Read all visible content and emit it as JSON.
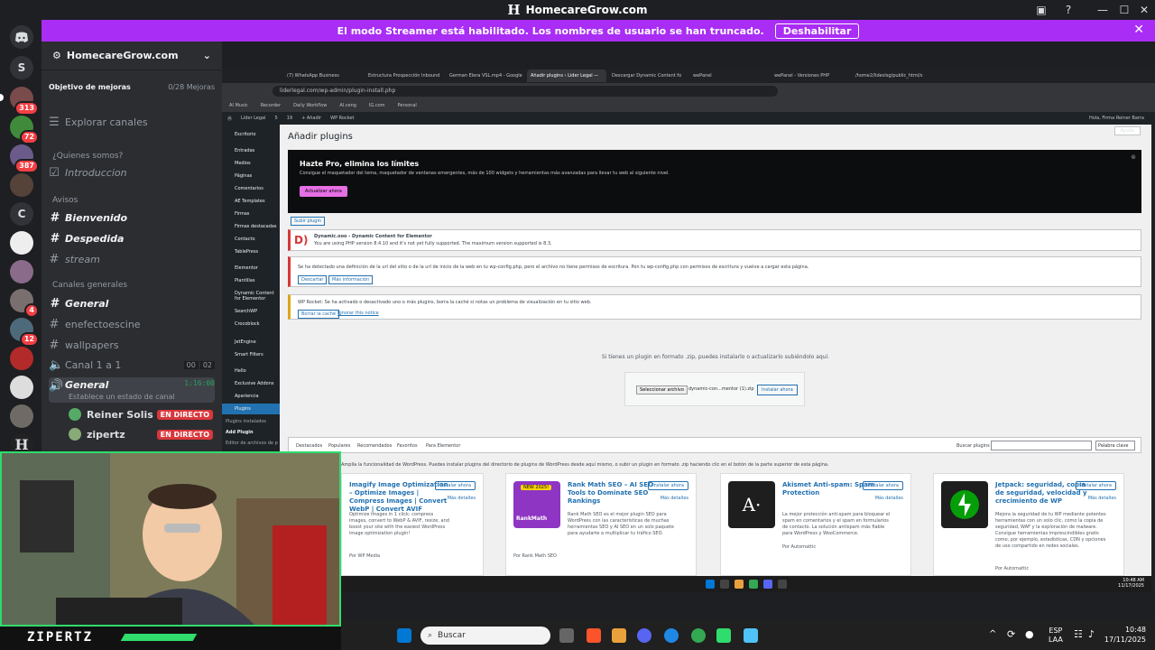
{
  "window": {
    "title": "HomecareGrow.com"
  },
  "streamer": {
    "message": "El modo Streamer está habilitado. Los nombres de usuario se han truncado.",
    "button": "Deshabilitar"
  },
  "rail": [
    {
      "label": "S"
    },
    {
      "label": "",
      "badge": "313"
    },
    {
      "label": "",
      "badge": "72"
    },
    {
      "label": "",
      "badge": "387"
    },
    {
      "label": "C"
    },
    {
      "label": ""
    },
    {
      "label": ""
    },
    {
      "label": "",
      "badge": "4"
    },
    {
      "label": "",
      "badge": "12"
    },
    {
      "label": ""
    },
    {
      "label": ""
    },
    {
      "label": ""
    },
    {
      "label": "H"
    }
  ],
  "sidebar": {
    "server_name": "HomecareGrow.com",
    "boost": {
      "label": "Objetivo de mejoras",
      "count": "0/28 Mejoras"
    },
    "explore": "Explorar canales",
    "cat1": "¿Quienes somos?",
    "intro": "Introduccion",
    "cat2": "Avisos",
    "ch_bienvenido": "Bienvenido",
    "ch_despedida": "Despedida",
    "ch_stream": "stream",
    "cat3": "Canales generales",
    "ch_general": "General",
    "ch_enefecto": "enefectoescine",
    "ch_wallpapers": "wallpapers",
    "ch_canal": "Canal 1 a 1",
    "canal_counts": [
      "00",
      "02"
    ],
    "voice": "General",
    "voice_time": "1:16:00",
    "voice_status": "Establece un estado de canal",
    "users": [
      {
        "name": "Reiner Solis",
        "badge": "EN DIRECTO"
      },
      {
        "name": "zipertz",
        "badge": "EN DIRECTO"
      }
    ]
  },
  "browser": {
    "tabs": [
      "(7) WhatsApp Business",
      "Estructura Prospección Inbound",
      "German Elera VSL.mp4 - Google",
      "Añadir plugins ‹ Lider Legal —",
      "Descargar Dynamic Content fo",
      "wePanel",
      "wePanel - Versiones PHP",
      "/home2/lideslsg/public_html/s"
    ],
    "url": "liderlegal.com/wp-admin/plugin-install.php",
    "bookmarks": [
      "AI Music",
      "Recorder",
      "Daily Workflow",
      "Al.ceng",
      "IG.com",
      "Personal"
    ]
  },
  "wp": {
    "adminbar": [
      "Líder Legal",
      "5",
      "19",
      "+ Añadir",
      "WP Rocket"
    ],
    "greeting": "Hola, Firma Reiner Barra",
    "menu": [
      "Escritorio",
      "Entradas",
      "Medios",
      "Páginas",
      "Comentarios",
      "AE Templates",
      "Firmas",
      "Firmas destacadas",
      "Contacto",
      "TablePress",
      "Elementor",
      "Plantillas",
      "Dynamic Content for Elementor",
      "SearchWP",
      "Crocoblock",
      "JetEngine",
      "Smart Filters",
      "Hello",
      "Exclusive Addons",
      "Apariencia",
      "Plugins",
      "Plugins instalados",
      "Add Plugin",
      "Editor de archivos de plugins"
    ],
    "page_title": "Añadir plugins",
    "help": "Ayuda",
    "promo": {
      "title": "Hazte Pro, elimina los límites",
      "desc": "Consigue el maquetador del tema, maquetador de ventanas emergentes, más de 100 widgets y herramientas más avanzadas para llevar tu web al siguiente nivel.",
      "button": "Actualizar ahora"
    },
    "upload_btn": "Subir plugin",
    "notice1": {
      "title": "Dynamic.ooo - Dynamic Content for Elementor",
      "text": "You are using PHP version 8.4.10 and it's not yet fully supported. The maximum version supported is 8.3."
    },
    "notice2": {
      "text": "Se ha detectado una definición de la url del sitio o de la url de inicio de la web en tu wp-config.php, pero el archivo no tiene permisos de escritura. Pon tu wp-config.php con permisos de escritura y vuelve a cargar esta página.",
      "b1": "Descartar",
      "b2": "Más información"
    },
    "notice3": {
      "text": "WP Rocket: Se ha activado o desactivado uno o más plugins, borra la caché si notas un problema de visualización en tu sitio web.",
      "b1": "Borrar la caché",
      "b2": "Ignorar this notice"
    },
    "upload_hint": "Si tienes un plugin en formato .zip, puedes instalarlo o actualizarlo subiéndolo aquí.",
    "choose_file": "Seleccionar archivo",
    "file_name": "dynamic-con...mentor (1).zip",
    "install_now": "Instalar ahora",
    "filters": [
      "Destacados",
      "Populares",
      "Recomendados",
      "Favoritos",
      "Para Elementor"
    ],
    "search_label": "Buscar plugins",
    "keyword": "Palabra clave",
    "directory_text": "Amplía la funcionalidad de WordPress. Puedes instalar plugins del directorio de plugins de WordPress desde aquí mismo, o subir un plugin en formato .zip haciendo clic en el botón de la parte superior de esta página."
  },
  "cards": [
    {
      "title": "Imagify Image Optimization – Optimize Images | Compress Images | Convert WebP | Convert AVIF",
      "install": "Instalar ahora",
      "details": "Más detalles",
      "desc": "Optimize images in 1 click: compress images, convert to WebP & AVIF, resize, and boost your site with the easiest WordPress image optimization plugin!",
      "by": "Por WP Media",
      "color": "#ffffff"
    },
    {
      "title": "Rank Math SEO – AI SEO Tools to Dominate SEO Rankings",
      "install": "Instalar ahora",
      "details": "Más detalles",
      "desc": "Rank Math SEO es el mejor plugin SEO para WordPress con las características de muchas herramientas SEO y AI SEO en un solo paquete para ayudarte a multiplicar tu tráfico SEO.",
      "by": "Por Rank Math SEO",
      "color": "#8e35c4",
      "badge": "NEW 2025!",
      "brand": "RankMath"
    },
    {
      "title": "Akismet Anti-spam: Spam Protection",
      "install": "Instalar ahora",
      "details": "Más detalles",
      "desc": "La mejor protección anti-spam para bloquear el spam en comentarios y el spam en formularios de contacto. La solución antispam más fiable para WordPress y WooCommerce.",
      "by": "Por Automattic",
      "color": "#1e1e1e",
      "brand": "A·"
    },
    {
      "title": "Jetpack: seguridad, copia de seguridad, velocidad y crecimiento de WP",
      "install": "Instalar ahora",
      "details": "Más detalles",
      "desc": "Mejora la seguridad de tu WP mediante potentes herramientas con un solo clic, como la copia de seguridad, WAF y la exploración de malware. Consigue herramientas imprescindibles gratis como, por ejemplo, estadísticas, CDN y opciones de uso compartido en redes sociales.",
      "by": "Por Automattic",
      "color": "#1e1e1e"
    }
  ],
  "webcam": {
    "name": "ZIPERTZ"
  },
  "taskbar": {
    "search": "Buscar",
    "lang": "ESP",
    "lang2": "LAA",
    "time": "10:48",
    "date": "17/11/2025"
  },
  "inner_clock": {
    "time": "10:48 AM",
    "date": "11/17/2025"
  }
}
